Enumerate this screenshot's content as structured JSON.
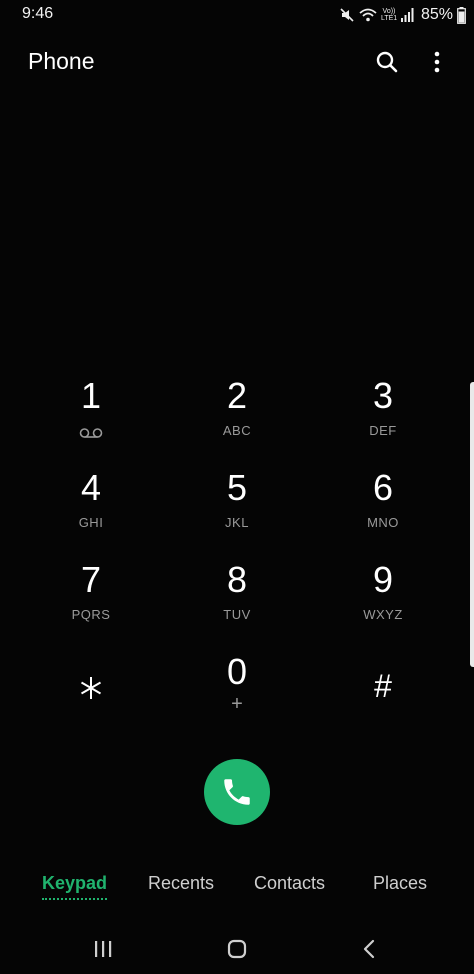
{
  "status_bar": {
    "time": "9:46",
    "lte_top": "Vo))",
    "lte_bottom": "LTE1",
    "battery": "85%",
    "icons": [
      "mute-icon",
      "wifi-icon",
      "signal-icon",
      "battery-icon"
    ]
  },
  "header": {
    "title": "Phone",
    "search_icon": "search-icon",
    "more_icon": "more-vertical-icon"
  },
  "keypad": {
    "keys": [
      {
        "digit": "1",
        "letters": "",
        "icon": "voicemail-icon"
      },
      {
        "digit": "2",
        "letters": "ABC"
      },
      {
        "digit": "3",
        "letters": "DEF"
      },
      {
        "digit": "4",
        "letters": "GHI"
      },
      {
        "digit": "5",
        "letters": "JKL"
      },
      {
        "digit": "6",
        "letters": "MNO"
      },
      {
        "digit": "7",
        "letters": "PQRS"
      },
      {
        "digit": "8",
        "letters": "TUV"
      },
      {
        "digit": "9",
        "letters": "WXYZ"
      },
      {
        "digit": "*",
        "letters": ""
      },
      {
        "digit": "0",
        "letters": "+"
      },
      {
        "digit": "#",
        "letters": ""
      }
    ]
  },
  "call_button": {
    "icon": "phone-icon",
    "color": "#1fb56f"
  },
  "tabs": [
    {
      "label": "Keypad",
      "active": true
    },
    {
      "label": "Recents",
      "active": false
    },
    {
      "label": "Contacts",
      "active": false
    },
    {
      "label": "Places",
      "active": false
    }
  ],
  "nav_bar": {
    "icons": [
      "recent-apps-icon",
      "home-icon",
      "back-icon"
    ]
  },
  "colors": {
    "accent": "#20b36e",
    "background": "#050505"
  }
}
